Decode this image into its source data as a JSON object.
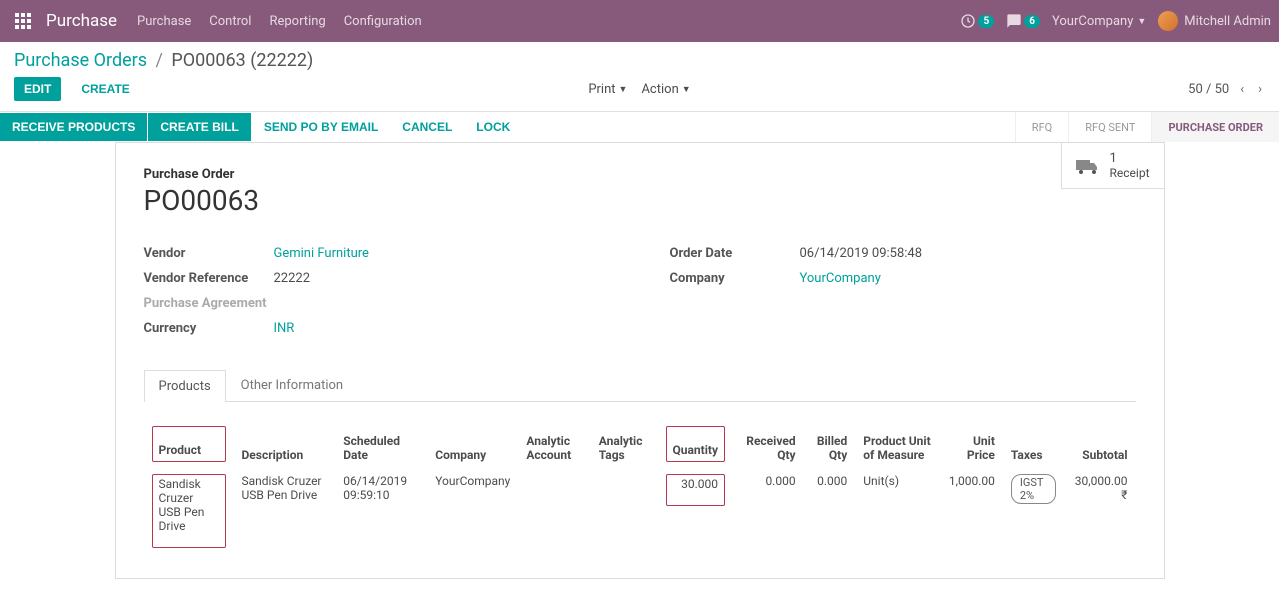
{
  "header": {
    "app_title": "Purchase",
    "nav": [
      "Purchase",
      "Control",
      "Reporting",
      "Configuration"
    ],
    "clock_badge": "5",
    "chat_badge": "6",
    "company": "YourCompany",
    "user": "Mitchell Admin"
  },
  "breadcrumb": {
    "parent": "Purchase Orders",
    "current": "PO00063 (22222)"
  },
  "control_panel": {
    "edit": "EDIT",
    "create": "CREATE",
    "print": "Print",
    "action": "Action",
    "pager": "50 / 50"
  },
  "action_bar": {
    "receive": "RECEIVE PRODUCTS",
    "create_bill": "CREATE BILL",
    "send_po": "SEND PO BY EMAIL",
    "cancel": "CANCEL",
    "lock": "LOCK",
    "steps": [
      "RFQ",
      "RFQ SENT",
      "PURCHASE ORDER"
    ]
  },
  "stat": {
    "count": "1",
    "label": "Receipt"
  },
  "record": {
    "title_label": "Purchase Order",
    "name": "PO00063",
    "labels": {
      "vendor": "Vendor",
      "vendor_ref": "Vendor Reference",
      "purchase_agreement": "Purchase Agreement",
      "currency": "Currency",
      "order_date": "Order Date",
      "company": "Company"
    },
    "vendor": "Gemini Furniture",
    "vendor_ref": "22222",
    "currency": "INR",
    "order_date": "06/14/2019 09:58:48",
    "company": "YourCompany"
  },
  "tabs": {
    "products": "Products",
    "other": "Other Information"
  },
  "table": {
    "headers": {
      "product": "Product",
      "description": "Description",
      "scheduled_date": "Scheduled Date",
      "company": "Company",
      "analytic_account": "Analytic Account",
      "analytic_tags": "Analytic Tags",
      "quantity": "Quantity",
      "received_qty": "Received Qty",
      "billed_qty": "Billed Qty",
      "uom": "Product Unit of Measure",
      "unit_price": "Unit Price",
      "taxes": "Taxes",
      "subtotal": "Subtotal"
    },
    "row": {
      "product": "Sandisk Cruzer USB Pen Drive",
      "description": "Sandisk Cruzer USB Pen Drive",
      "scheduled_date": "06/14/2019 09:59:10",
      "company": "YourCompany",
      "analytic_account": "",
      "analytic_tags": "",
      "quantity": "30.000",
      "received_qty": "0.000",
      "billed_qty": "0.000",
      "uom": "Unit(s)",
      "unit_price": "1,000.00",
      "taxes": "IGST 2%",
      "subtotal": "30,000.00 ₹"
    }
  }
}
